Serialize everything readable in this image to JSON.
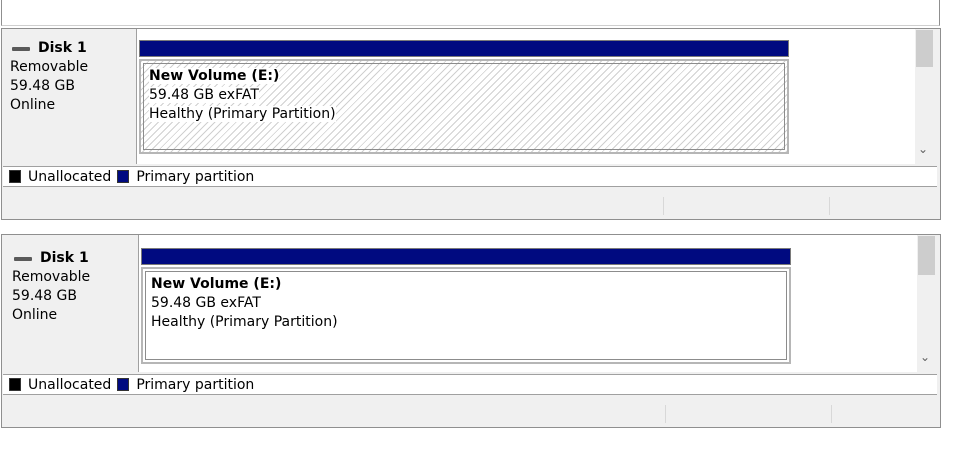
{
  "panels": [
    {
      "disk": {
        "title": "Disk 1",
        "type": "Removable",
        "size": "59.48 GB",
        "status": "Online"
      },
      "volume": {
        "name": "New Volume  (E:)",
        "size_fs": "59.48 GB exFAT",
        "health": "Healthy (Primary Partition)"
      },
      "legend": {
        "unallocated": "Unallocated",
        "primary": "Primary partition"
      }
    },
    {
      "disk": {
        "title": "Disk 1",
        "type": "Removable",
        "size": "59.48 GB",
        "status": "Online"
      },
      "volume": {
        "name": "New Volume  (E:)",
        "size_fs": "59.48 GB exFAT",
        "health": "Healthy (Primary Partition)"
      },
      "legend": {
        "unallocated": "Unallocated",
        "primary": "Primary partition"
      }
    }
  ],
  "colors": {
    "primary_partition": "#000a80",
    "unallocated": "#000000"
  }
}
